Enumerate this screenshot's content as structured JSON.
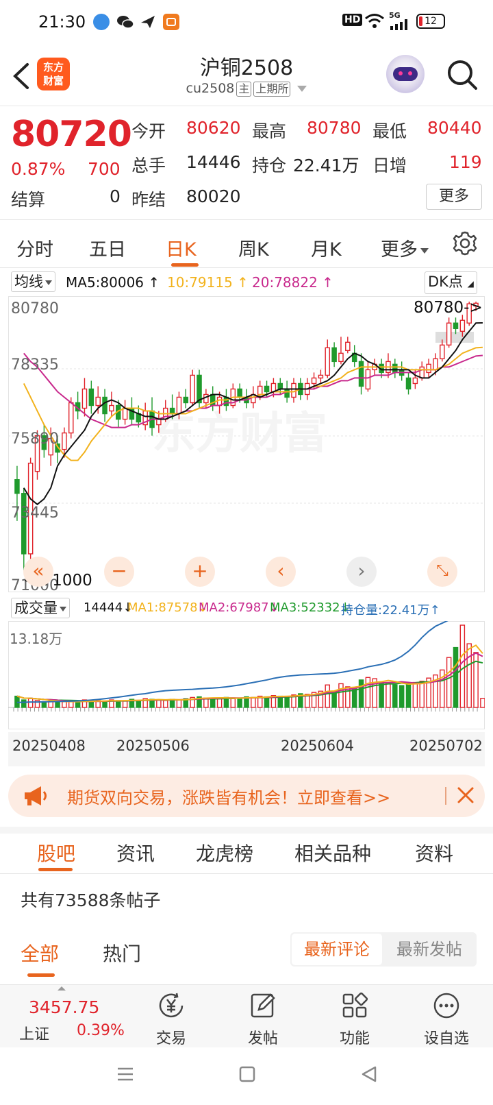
{
  "status": {
    "time": "21:30",
    "battery": "12",
    "network": "5G",
    "hd": "HD"
  },
  "header": {
    "logo_text_1": "东方",
    "logo_text_2": "财富",
    "title": "沪铜2508",
    "code": "cu2508",
    "tag_main": "主",
    "tag_exchange": "上期所"
  },
  "quote": {
    "price": "80720",
    "change_pct": "0.87%",
    "change": "700",
    "open_label": "今开",
    "open": "80620",
    "high_label": "最高",
    "high": "80780",
    "low_label": "最低",
    "low": "80440",
    "volume_label": "总手",
    "volume": "14446",
    "oi_label": "持仓",
    "oi": "22.41万",
    "daily_inc_label": "日增",
    "daily_inc": "119",
    "settle_label": "结算",
    "settle": "0",
    "prev_settle_label": "昨结",
    "prev_settle": "80020",
    "more_button": "更多"
  },
  "period_tabs": [
    "分时",
    "五日",
    "日K",
    "周K",
    "月K",
    "更多"
  ],
  "active_period": 2,
  "ma_legend": {
    "button": "均线",
    "ma5": "MA5:80006",
    "ma10": "10:79115",
    "ma20": "20:78822",
    "dk_button": "DK点"
  },
  "price_axis": [
    "80780",
    "78335",
    "75890",
    "73445",
    "71000"
  ],
  "annotations": {
    "high": "80780->",
    "low": "<-71000"
  },
  "volume_legend": {
    "button": "成交量",
    "vol": "14444",
    "ma1": "MA1:87578",
    "ma2": "MA2:67987",
    "ma3": "MA3:52332",
    "oi": "持仓量:22.41万",
    "max_label": "13.18万"
  },
  "date_axis": [
    "20250408",
    "20250506",
    "20250604",
    "20250702"
  ],
  "colors": {
    "up": "#e0232b",
    "down": "#1f9a2c",
    "accent": "#e8641e",
    "ma5": "#111111",
    "ma10": "#f2b21c",
    "ma20": "#c8288c",
    "oi_line": "#2a6fb5"
  },
  "chart_data": {
    "type": "candlestick",
    "ylim": [
      71000,
      80780
    ],
    "candles": [
      {
        "o": 74300,
        "c": 73800,
        "h": 74800,
        "l": 72800
      },
      {
        "o": 73800,
        "c": 71600,
        "h": 74000,
        "l": 71000
      },
      {
        "o": 71600,
        "c": 74900,
        "h": 75100,
        "l": 71400
      },
      {
        "o": 74600,
        "c": 75900,
        "h": 76100,
        "l": 74300
      },
      {
        "o": 75900,
        "c": 75400,
        "h": 76300,
        "l": 75100
      },
      {
        "o": 75200,
        "c": 75800,
        "h": 76200,
        "l": 74800
      },
      {
        "o": 75600,
        "c": 75300,
        "h": 75900,
        "l": 74900
      },
      {
        "o": 75400,
        "c": 76000,
        "h": 76200,
        "l": 75100
      },
      {
        "o": 76000,
        "c": 77100,
        "h": 77300,
        "l": 75800
      },
      {
        "o": 77100,
        "c": 76800,
        "h": 77500,
        "l": 76500
      },
      {
        "o": 76900,
        "c": 77600,
        "h": 78000,
        "l": 76600
      },
      {
        "o": 77600,
        "c": 77000,
        "h": 77900,
        "l": 76700
      },
      {
        "o": 77000,
        "c": 77300,
        "h": 77700,
        "l": 76700
      },
      {
        "o": 77300,
        "c": 76700,
        "h": 77600,
        "l": 76400
      },
      {
        "o": 76800,
        "c": 77000,
        "h": 77500,
        "l": 76600
      },
      {
        "o": 77000,
        "c": 76500,
        "h": 77200,
        "l": 76200
      },
      {
        "o": 76500,
        "c": 76900,
        "h": 77200,
        "l": 76300
      },
      {
        "o": 76900,
        "c": 76500,
        "h": 77300,
        "l": 76300
      },
      {
        "o": 76700,
        "c": 76400,
        "h": 77000,
        "l": 76200
      },
      {
        "o": 76300,
        "c": 76800,
        "h": 77100,
        "l": 76100
      },
      {
        "o": 76800,
        "c": 76200,
        "h": 77300,
        "l": 75900
      },
      {
        "o": 76300,
        "c": 76500,
        "h": 76800,
        "l": 76000
      },
      {
        "o": 76500,
        "c": 76900,
        "h": 77200,
        "l": 76400
      },
      {
        "o": 76900,
        "c": 76700,
        "h": 77400,
        "l": 76500
      },
      {
        "o": 76700,
        "c": 77300,
        "h": 77500,
        "l": 76500
      },
      {
        "o": 77300,
        "c": 77100,
        "h": 77600,
        "l": 76900
      },
      {
        "o": 77100,
        "c": 78100,
        "h": 78300,
        "l": 77000
      },
      {
        "o": 78100,
        "c": 77100,
        "h": 78300,
        "l": 76900
      },
      {
        "o": 77100,
        "c": 77400,
        "h": 77600,
        "l": 76900
      },
      {
        "o": 77400,
        "c": 77000,
        "h": 77700,
        "l": 76800
      },
      {
        "o": 77000,
        "c": 77300,
        "h": 77500,
        "l": 76700
      },
      {
        "o": 77300,
        "c": 77000,
        "h": 77600,
        "l": 76800
      },
      {
        "o": 77000,
        "c": 77600,
        "h": 77800,
        "l": 76900
      },
      {
        "o": 77600,
        "c": 77300,
        "h": 77800,
        "l": 77100
      },
      {
        "o": 77300,
        "c": 77100,
        "h": 77600,
        "l": 76900
      },
      {
        "o": 77100,
        "c": 77400,
        "h": 77700,
        "l": 76900
      },
      {
        "o": 77400,
        "c": 77700,
        "h": 77900,
        "l": 77200
      },
      {
        "o": 77700,
        "c": 77500,
        "h": 77900,
        "l": 77300
      },
      {
        "o": 77500,
        "c": 77800,
        "h": 78000,
        "l": 77300
      },
      {
        "o": 77800,
        "c": 77600,
        "h": 78000,
        "l": 77400
      },
      {
        "o": 77600,
        "c": 77300,
        "h": 77900,
        "l": 77100
      },
      {
        "o": 77300,
        "c": 77800,
        "h": 78000,
        "l": 77100
      },
      {
        "o": 77800,
        "c": 77400,
        "h": 78000,
        "l": 77200
      },
      {
        "o": 77400,
        "c": 77800,
        "h": 78000,
        "l": 77200
      },
      {
        "o": 77800,
        "c": 78000,
        "h": 78200,
        "l": 77600
      },
      {
        "o": 78000,
        "c": 78100,
        "h": 78300,
        "l": 77800
      },
      {
        "o": 78100,
        "c": 79100,
        "h": 79400,
        "l": 78000
      },
      {
        "o": 79100,
        "c": 78600,
        "h": 79300,
        "l": 78400
      },
      {
        "o": 78600,
        "c": 78900,
        "h": 79500,
        "l": 78500
      },
      {
        "o": 79000,
        "c": 79300,
        "h": 79500,
        "l": 78900
      },
      {
        "o": 78900,
        "c": 78600,
        "h": 79200,
        "l": 78400
      },
      {
        "o": 78600,
        "c": 77700,
        "h": 78900,
        "l": 77400
      },
      {
        "o": 77600,
        "c": 78300,
        "h": 78600,
        "l": 77500
      },
      {
        "o": 78300,
        "c": 78500,
        "h": 78700,
        "l": 78100
      },
      {
        "o": 78500,
        "c": 78200,
        "h": 78700,
        "l": 78000
      },
      {
        "o": 78200,
        "c": 78600,
        "h": 78900,
        "l": 78000
      },
      {
        "o": 78500,
        "c": 78200,
        "h": 78700,
        "l": 78000
      },
      {
        "o": 78300,
        "c": 78100,
        "h": 78600,
        "l": 77900
      },
      {
        "o": 78000,
        "c": 77600,
        "h": 78200,
        "l": 77400
      },
      {
        "o": 77800,
        "c": 78000,
        "h": 78300,
        "l": 77600
      },
      {
        "o": 78000,
        "c": 78400,
        "h": 78600,
        "l": 77900
      },
      {
        "o": 78200,
        "c": 78500,
        "h": 78700,
        "l": 78000
      },
      {
        "o": 78300,
        "c": 78700,
        "h": 78900,
        "l": 78100
      },
      {
        "o": 78700,
        "c": 79200,
        "h": 79400,
        "l": 78600
      },
      {
        "o": 79200,
        "c": 80000,
        "h": 80200,
        "l": 79100
      },
      {
        "o": 80000,
        "c": 79800,
        "h": 80200,
        "l": 79600
      },
      {
        "o": 79700,
        "c": 80100,
        "h": 80300,
        "l": 79500
      },
      {
        "o": 80000,
        "c": 80700,
        "h": 80780,
        "l": 79900
      },
      {
        "o": 80620,
        "c": 80720,
        "h": 80780,
        "l": 80440
      }
    ],
    "ma5": [
      74000,
      73600,
      73400,
      73600,
      74000,
      74800,
      75200,
      75500,
      75800,
      76100,
      76600,
      76900,
      77100,
      77200,
      77100,
      76900,
      76800,
      76700,
      76600,
      76600,
      76500,
      76500,
      76600,
      76700,
      76800,
      77000,
      77200,
      77300,
      77400,
      77400,
      77300,
      77200,
      77200,
      77300,
      77400,
      77300,
      77400,
      77500,
      77600,
      77600,
      77600,
      77600,
      77600,
      77700,
      77800,
      77900,
      78100,
      78400,
      78700,
      78900,
      78800,
      78600,
      78500,
      78300,
      78300,
      78300,
      78300,
      78300,
      78100,
      78000,
      78000,
      78200,
      78400,
      78700,
      79000,
      79400,
      79700,
      80000,
      80006
    ],
    "ma10": [
      77800,
      77300,
      76800,
      76300,
      75900,
      75500,
      75200,
      75000,
      75000,
      75300,
      75700,
      76000,
      76300,
      76600,
      76800,
      76900,
      76900,
      76900,
      76800,
      76800,
      76700,
      76700,
      76700,
      76700,
      76700,
      76800,
      76900,
      77000,
      77100,
      77200,
      77200,
      77300,
      77300,
      77300,
      77300,
      77400,
      77400,
      77500,
      77500,
      77500,
      77500,
      77600,
      77600,
      77700,
      77700,
      77800,
      77900,
      78000,
      78200,
      78300,
      78400,
      78400,
      78400,
      78400,
      78400,
      78400,
      78400,
      78300,
      78300,
      78300,
      78300,
      78300,
      78400,
      78500,
      78700,
      78900,
      79000,
      79100,
      79115
    ],
    "ma20": [
      78900,
      78600,
      78400,
      78100,
      77800,
      77500,
      77300,
      77100,
      76900,
      76700,
      76500,
      76400,
      76300,
      76200,
      76200,
      76200,
      76300,
      76300,
      76400,
      76500,
      76500,
      76600,
      76600,
      76700,
      76800,
      76800,
      76900,
      76900,
      77000,
      77000,
      77100,
      77100,
      77200,
      77200,
      77300,
      77300,
      77300,
      77400,
      77400,
      77500,
      77500,
      77600,
      77600,
      77600,
      77700,
      77700,
      77800,
      77900,
      77900,
      78000,
      78000,
      78000,
      78100,
      78100,
      78100,
      78200,
      78200,
      78200,
      78200,
      78300,
      78300,
      78300,
      78400,
      78400,
      78500,
      78600,
      78700,
      78800,
      78822
    ],
    "volume_ylim": [
      0,
      131800
    ],
    "volume": [
      18000,
      12000,
      14000,
      11000,
      9000,
      10000,
      8000,
      9000,
      10000,
      9000,
      12000,
      9000,
      11000,
      10000,
      12000,
      11000,
      10000,
      13000,
      11000,
      14000,
      13000,
      12000,
      11000,
      13000,
      12000,
      14000,
      16000,
      17000,
      15000,
      14000,
      15000,
      16000,
      14000,
      15000,
      17000,
      16000,
      18000,
      17000,
      19000,
      18000,
      17000,
      20000,
      22000,
      21000,
      24000,
      26000,
      36000,
      25000,
      38000,
      33000,
      30000,
      44000,
      48000,
      46000,
      38000,
      40000,
      36000,
      35000,
      38000,
      40000,
      42000,
      47000,
      52000,
      60000,
      80000,
      96000,
      131800,
      102000,
      88000,
      14444
    ],
    "oi": [
      8000,
      8200,
      8600,
      8700,
      8900,
      9200,
      9500,
      9800,
      10000,
      10400,
      11000,
      11800,
      12800,
      14000,
      15200,
      16500,
      18000,
      19500,
      21000,
      22000,
      24000,
      25500,
      26800,
      27500,
      28000,
      28600,
      29000,
      29800,
      30500,
      31000,
      31800,
      33000,
      34500,
      36000,
      38000,
      40000,
      42000,
      44000,
      46500,
      48500,
      50000,
      51000,
      52000,
      52500,
      53000,
      53500,
      54000,
      54800,
      56000,
      58000,
      60000,
      62000,
      65000,
      67000,
      69000,
      72000,
      76000,
      82000,
      90000,
      100000,
      112000,
      122000,
      130000,
      135000,
      140000,
      145000,
      150000,
      152000,
      152000,
      152000
    ],
    "series": [
      {
        "name": "MA1",
        "values": []
      },
      {
        "name": "MA2",
        "values": []
      },
      {
        "name": "MA3",
        "values": []
      }
    ]
  },
  "banner": {
    "text": "期货双向交易，涨跌皆有机会！立即查看>>"
  },
  "section_tabs": [
    "股吧",
    "资讯",
    "龙虎榜",
    "相关品种",
    "资料"
  ],
  "posts_count": "共有73588条帖子",
  "filter_tabs": [
    "全部",
    "热门"
  ],
  "sort": {
    "latest_comment": "最新评论",
    "latest_post": "最新发帖"
  },
  "bottom": {
    "index_value": "3457.75",
    "index_name": "上证",
    "index_change": "0.39%",
    "trade": "交易",
    "post": "发帖",
    "func": "功能",
    "watch": "设自选"
  }
}
